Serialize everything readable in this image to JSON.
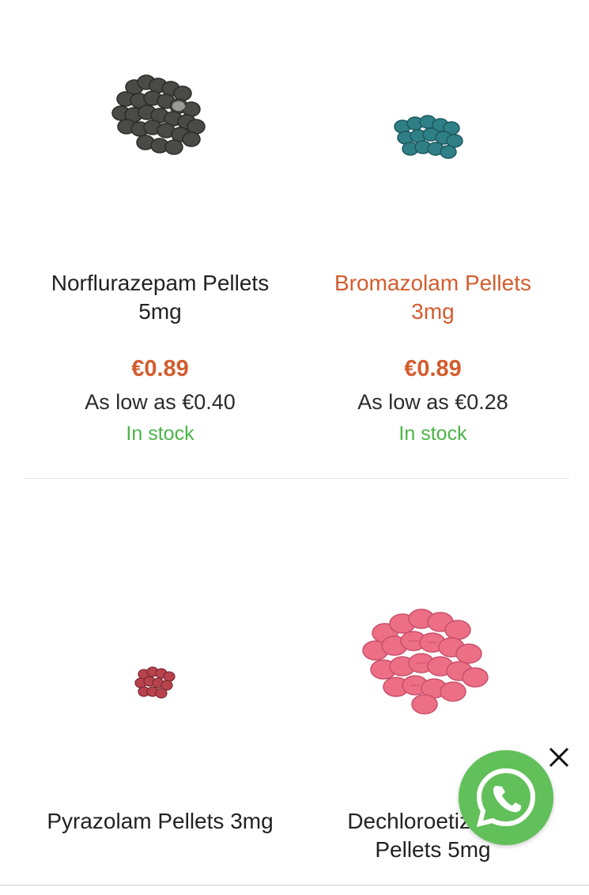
{
  "products": [
    {
      "name": "Norflurazepam Pellets 5mg",
      "name_highlighted": false,
      "price": "€0.89",
      "low_price": "As low as €0.40",
      "stock": "In stock",
      "image_color": "#4a4a46"
    },
    {
      "name": "Bromazolam Pellets 3mg",
      "name_highlighted": true,
      "price": "€0.89",
      "low_price": "As low as €0.28",
      "stock": "In stock",
      "image_color": "#2f7f86"
    },
    {
      "name": "Pyrazolam Pellets 3mg",
      "name_highlighted": false,
      "image_color": "#b8434d"
    },
    {
      "name": "Dechloroetizolam Pellets 5mg",
      "name_highlighted": false,
      "image_color": "#ec6f86"
    }
  ],
  "colors": {
    "accent": "#d35d2e",
    "in_stock": "#4bb546",
    "whatsapp": "#62c05a"
  },
  "whatsapp": {
    "icon": "whatsapp-icon"
  },
  "close": {
    "icon": "close-icon"
  }
}
